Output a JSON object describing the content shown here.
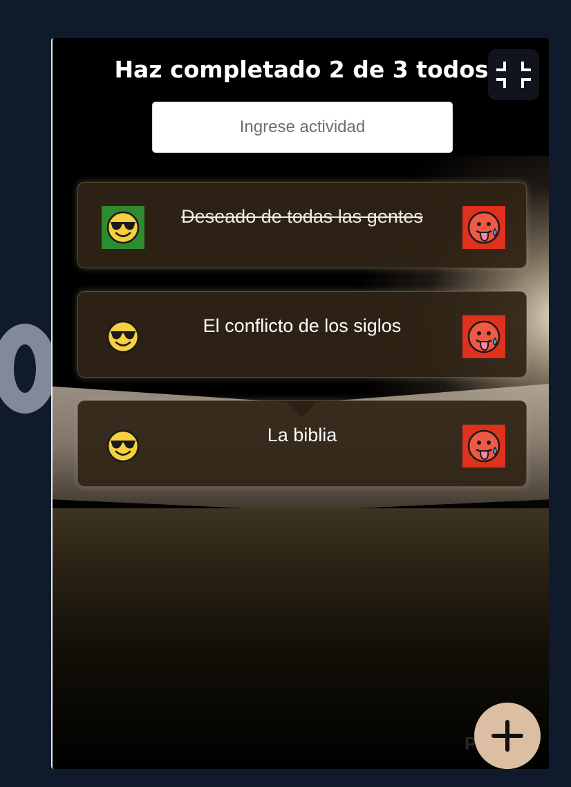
{
  "header": {
    "title": "Haz completado 2 de 3 todos"
  },
  "search": {
    "placeholder": "Ingrese actividad"
  },
  "todos": [
    {
      "text": "Deseado de todas las gentes",
      "completed": true
    },
    {
      "text": "El conflicto de los siglos",
      "completed": false
    },
    {
      "text": "La biblia",
      "completed": false
    }
  ],
  "icons": {
    "complete": "sunglasses-face-icon",
    "delete": "hot-face-icon",
    "fullscreen": "exit-fullscreen-icon",
    "add": "plus-icon"
  },
  "watermark": "Platzi",
  "colors": {
    "page_bg": "#0f1a2c",
    "done_green": "#2e8c2e",
    "delete_red": "#e0301e",
    "fab": "#dcbfa2"
  }
}
